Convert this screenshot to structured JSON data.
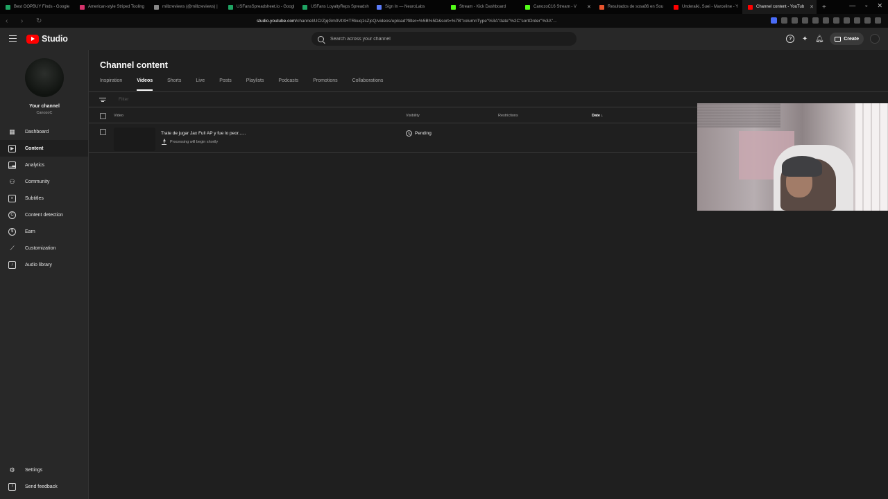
{
  "browser": {
    "tabs": [
      {
        "label": "Best OOPBUY Finds - Google",
        "color": "#1fa463"
      },
      {
        "label": "American-style Striped Tooling",
        "color": "#d6336c"
      },
      {
        "label": "millzreviews (@millzreviews) |",
        "color": "#888888"
      },
      {
        "label": "USFansSpreadsheet.io - Googl",
        "color": "#1fa463"
      },
      {
        "label": "USFans LoyaltyReps Spreadsh",
        "color": "#1fa463"
      },
      {
        "label": "Sign In — NeuroLabs",
        "color": "#5b7cfa"
      },
      {
        "label": "Stream - Kick Dashboard",
        "color": "#53fc18"
      },
      {
        "label": "CanozoC16 Stream - V",
        "color": "#53fc18"
      },
      {
        "label": "Resultados de sosa86 en Sou",
        "color": "#e8542d"
      },
      {
        "label": "Underaiki, Suei - Marceline - Y",
        "color": "#ff0000"
      },
      {
        "label": "Channel content - YouTub",
        "color": "#ff0000",
        "active": true
      }
    ],
    "url_host": "studio.youtube.com",
    "url_path": "/channel/UCrZjqGm0VtXHTRkuq1sZjcQ/videos/upload?filter=%5B%5D&sort=%7B\"columnType\"%3A\"date\"%2C\"sortOrder\"%3A\"..."
  },
  "header": {
    "logo_text": "Studio",
    "search_placeholder": "Search across your channel",
    "create_label": "Create"
  },
  "sidebar": {
    "your_channel": "Your channel",
    "handle": "CanozoC",
    "items": [
      {
        "label": "Dashboard",
        "icon": "dashboard-icon"
      },
      {
        "label": "Content",
        "icon": "content-icon",
        "active": true
      },
      {
        "label": "Analytics",
        "icon": "analytics-icon"
      },
      {
        "label": "Community",
        "icon": "community-icon"
      },
      {
        "label": "Subtitles",
        "icon": "subtitles-icon"
      },
      {
        "label": "Content detection",
        "icon": "copyright-icon"
      },
      {
        "label": "Earn",
        "icon": "dollar-icon"
      },
      {
        "label": "Customization",
        "icon": "magic-wand-icon"
      },
      {
        "label": "Audio library",
        "icon": "audio-library-icon"
      }
    ],
    "bottom": [
      {
        "label": "Settings",
        "icon": "gear-icon"
      },
      {
        "label": "Send feedback",
        "icon": "feedback-icon"
      }
    ]
  },
  "main": {
    "title": "Channel content",
    "tabs": [
      {
        "label": "Inspiration"
      },
      {
        "label": "Videos",
        "active": true
      },
      {
        "label": "Shorts"
      },
      {
        "label": "Live"
      },
      {
        "label": "Posts"
      },
      {
        "label": "Playlists"
      },
      {
        "label": "Podcasts"
      },
      {
        "label": "Promotions"
      },
      {
        "label": "Collaborations"
      }
    ],
    "filter_placeholder": "Filter",
    "columns": {
      "video": "Video",
      "visibility": "Visibility",
      "restrictions": "Restrictions",
      "date": "Date ↓"
    },
    "rows": [
      {
        "title": "Trate de jugar Jax Full AP y fue lo peor......",
        "status": "Processing will begin shortly",
        "visibility": "Pending"
      }
    ]
  }
}
